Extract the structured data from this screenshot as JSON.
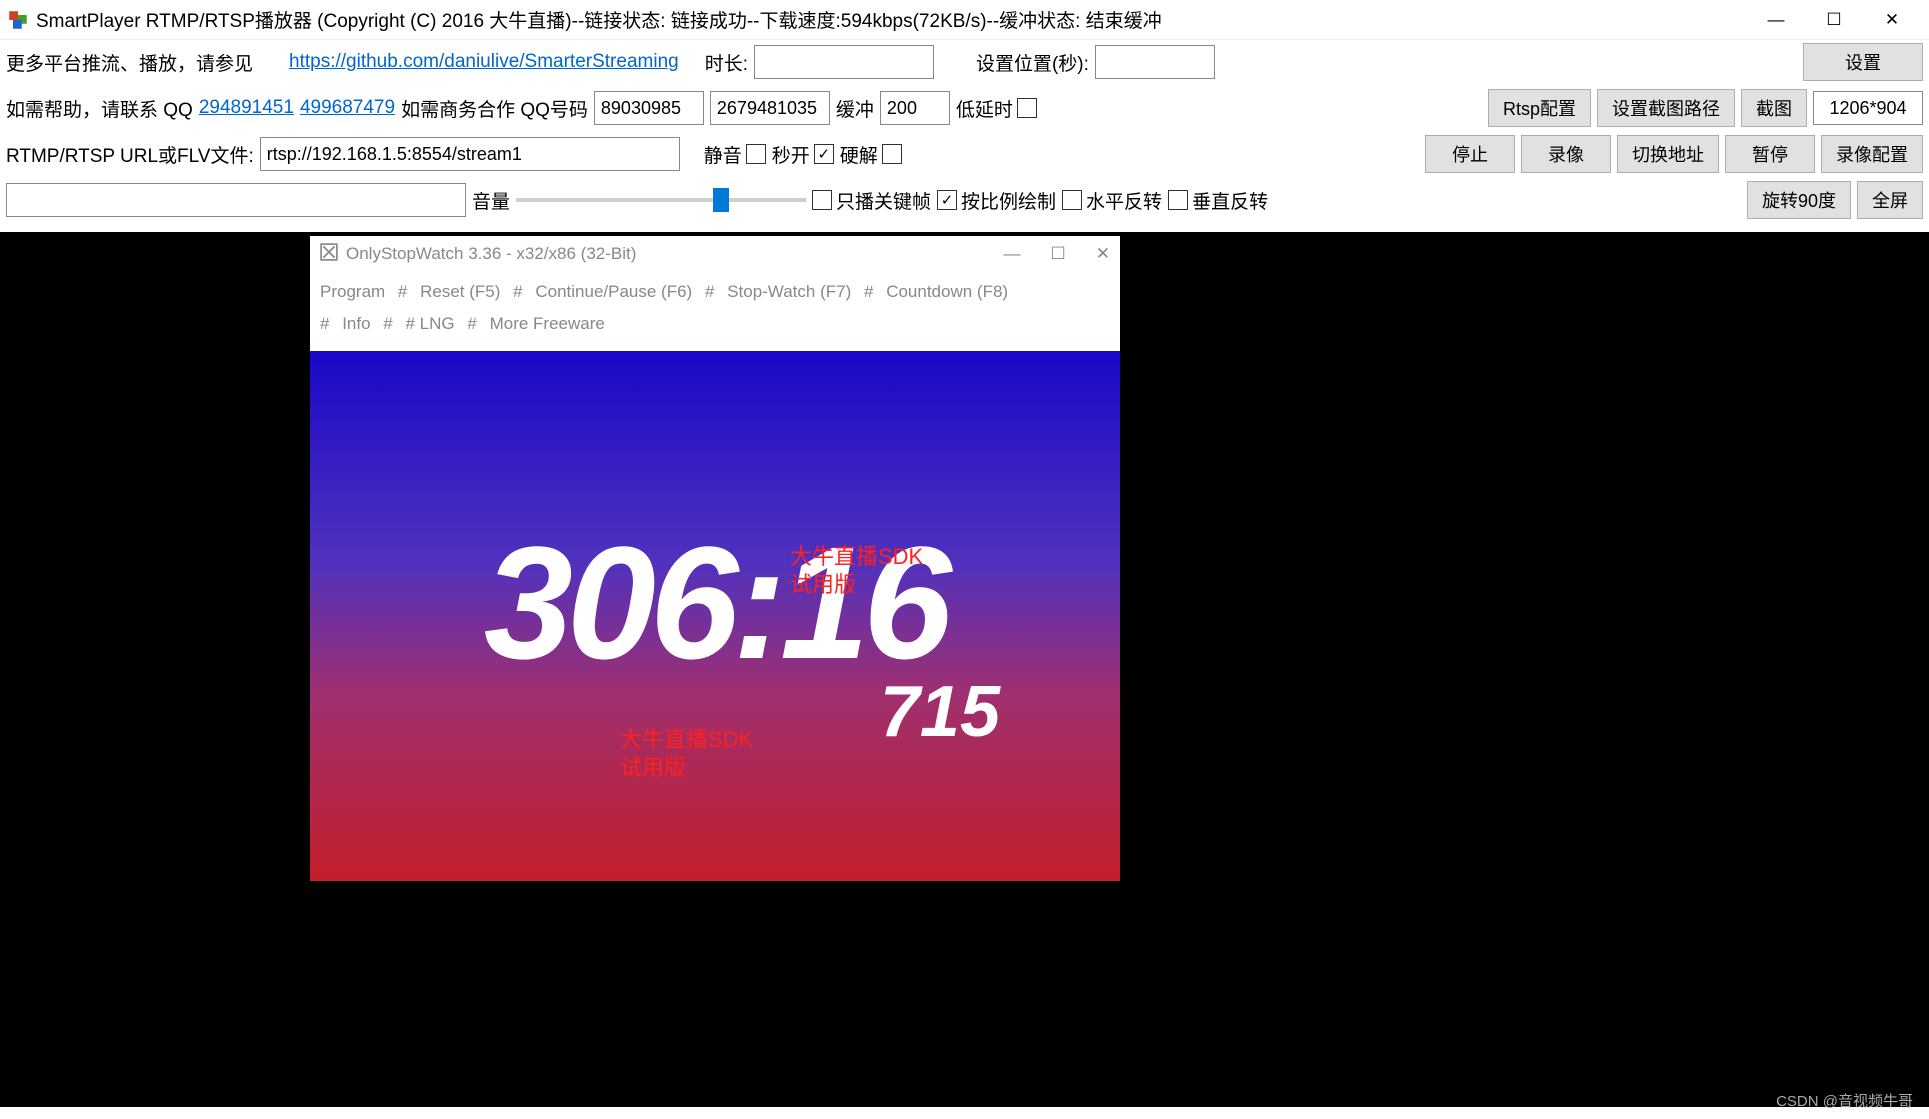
{
  "titlebar": {
    "text": "SmartPlayer RTMP/RTSP播放器 (Copyright (C) 2016 大牛直播)--链接状态: 链接成功--下载速度:594kbps(72KB/s)--缓冲状态: 结束缓冲"
  },
  "row1": {
    "more_platforms": "更多平台推流、播放，请参见",
    "github_link": "https://github.com/daniulive/SmarterStreaming",
    "duration_label": "时长:",
    "duration_value": "",
    "set_position_label": "设置位置(秒):",
    "set_position_value": "",
    "settings_btn": "设置"
  },
  "row2": {
    "help_label": "如需帮助，请联系 QQ",
    "qq1": "294891451",
    "qq2": "499687479",
    "biz_label": "如需商务合作 QQ号码",
    "biz_qq1": "89030985",
    "biz_qq2": "2679481035",
    "buffer_label": "缓冲",
    "buffer_value": "200",
    "low_latency_label": "低延时",
    "rtsp_config_btn": "Rtsp配置",
    "screenshot_path_btn": "设置截图路径",
    "screenshot_btn": "截图",
    "resolution": "1206*904"
  },
  "row3": {
    "url_label": "RTMP/RTSP URL或FLV文件:",
    "url_value": "rtsp://192.168.1.5:8554/stream1",
    "mute_label": "静音",
    "fast_open_label": "秒开",
    "hw_decode_label": "硬解",
    "stop_btn": "停止",
    "record_btn": "录像",
    "switch_addr_btn": "切换地址",
    "pause_btn": "暂停",
    "record_config_btn": "录像配置"
  },
  "row4": {
    "volume_label": "音量",
    "keyframe_only_label": "只播关键帧",
    "scale_draw_label": "按比例绘制",
    "hflip_label": "水平反转",
    "vflip_label": "垂直反转",
    "rotate_btn": "旋转90度",
    "fullscreen_btn": "全屏"
  },
  "checkboxes": {
    "low_latency": false,
    "mute": false,
    "fast_open": true,
    "hw_decode": false,
    "keyframe_only": false,
    "scale_draw": true,
    "hflip": false,
    "vflip": false
  },
  "subwindow": {
    "title": "OnlyStopWatch 3.36 - x32/x86 (32-Bit)",
    "menu": {
      "program": "Program",
      "reset": "Reset  (F5)",
      "continue": "Continue/Pause  (F6)",
      "stopwatch": "Stop-Watch  (F7)",
      "countdown": "Countdown  (F8)",
      "info": "Info",
      "lng": "# LNG",
      "more": "More Freeware",
      "sep": "#"
    },
    "timer_main": "306:16",
    "timer_sub": "715",
    "watermark_line1": "大牛直播SDK",
    "watermark_line2": "试用版"
  },
  "footer": "CSDN @音视频牛哥",
  "volume_percent": 72
}
